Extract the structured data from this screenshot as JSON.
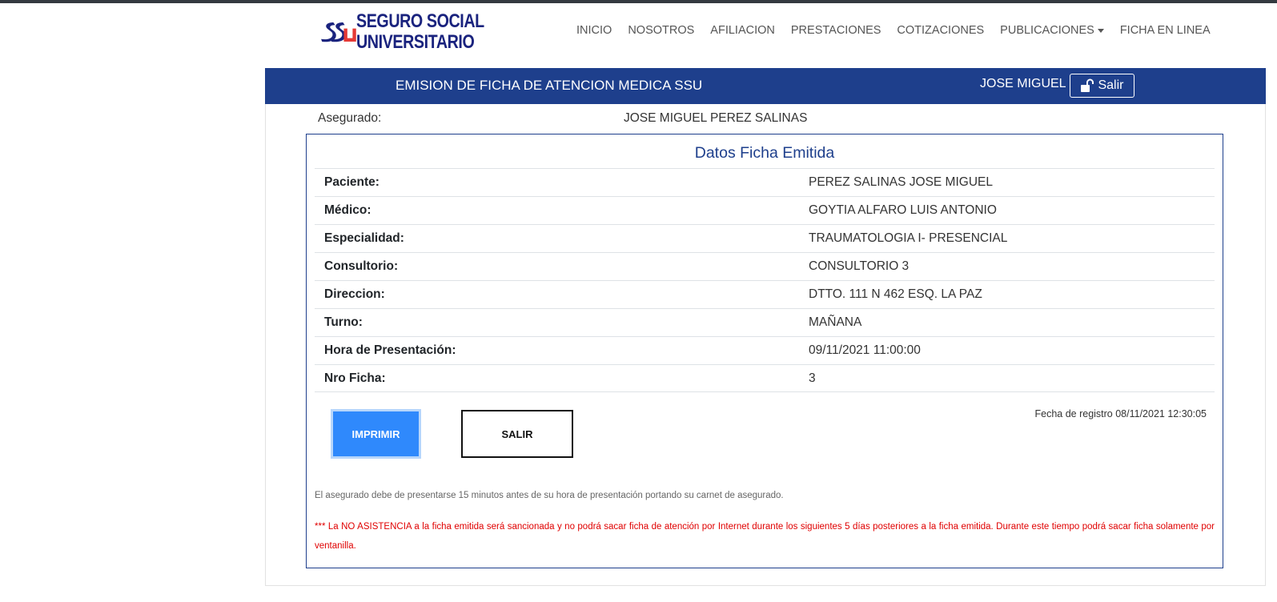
{
  "brand": {
    "name_line1": "SEGURO SOCIAL",
    "name_line2": "UNIVERSITARIO",
    "logo_icon": "ssu-logo-icon",
    "colors": {
      "navy": "#1a237e",
      "red": "#e53935"
    }
  },
  "nav": {
    "items": [
      {
        "label": "INICIO"
      },
      {
        "label": "NOSOTROS"
      },
      {
        "label": "AFILIACION"
      },
      {
        "label": "PRESTACIONES"
      },
      {
        "label": "COTIZACIONES"
      },
      {
        "label": "PUBLICACIONES"
      },
      {
        "label": "FICHA EN LINEA"
      }
    ]
  },
  "header": {
    "title": "EMISION DE FICHA DE ATENCION MEDICA SSU",
    "user": "JOSE MIGUEL",
    "exit_label": "Salir",
    "exit_icon": "unlock-icon",
    "color": "#1e3f8c"
  },
  "insured": {
    "label": "Asegurado:",
    "name": "JOSE MIGUEL PEREZ SALINAS"
  },
  "ficha": {
    "title": "Datos Ficha Emitida",
    "rows": [
      {
        "label": "Paciente:",
        "value": "PEREZ SALINAS JOSE MIGUEL"
      },
      {
        "label": "Médico:",
        "value": "GOYTIA ALFARO LUIS ANTONIO"
      },
      {
        "label": "Especialidad:",
        "value": "TRAUMATOLOGIA I- PRESENCIAL"
      },
      {
        "label": "Consultorio:",
        "value": "CONSULTORIO 3"
      },
      {
        "label": "Direccion:",
        "value": "DTTO. 111 N 462 ESQ. LA PAZ"
      },
      {
        "label": "Turno:",
        "value": "MAÑANA"
      },
      {
        "label": "Hora de Presentación:",
        "value": "09/11/2021 11:00:00"
      },
      {
        "label": "Nro Ficha:",
        "value": "3"
      }
    ],
    "print_label": "IMPRIMIR",
    "exit_label": "SALIR",
    "registration": "Fecha de registro 08/11/2021 12:30:05"
  },
  "notes": {
    "arrival": "El asegurado debe de presentarse 15 minutos antes de su hora de presentación portando su carnet de asegurado.",
    "warning": "*** La NO ASISTENCIA a la ficha emitida será sancionada y no podrá sacar ficha de atención por Internet durante los siguientes 5 días posteriores a la ficha emitida. Durante este tiempo podrá sacar ficha solamente por ventanilla.",
    "warning_color": "#e00000"
  }
}
